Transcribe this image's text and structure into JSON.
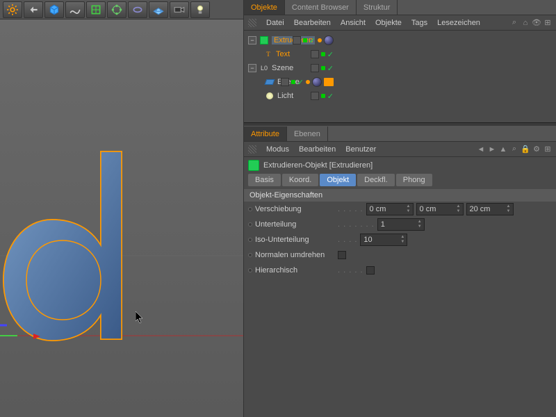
{
  "panel_tabs": {
    "objects": "Objekte",
    "content_browser": "Content Browser",
    "structure": "Struktur"
  },
  "obj_menu": {
    "file": "Datei",
    "edit": "Bearbeiten",
    "view": "Ansicht",
    "objects": "Objekte",
    "tags": "Tags",
    "bookmarks": "Lesezeichen"
  },
  "tree": {
    "extrude": "Extrudieren",
    "text": "Text",
    "scene": "Szene",
    "plane": "Ebene",
    "light": "Licht"
  },
  "attr_tabs": {
    "attributes": "Attribute",
    "layers": "Ebenen"
  },
  "attr_menu": {
    "mode": "Modus",
    "edit": "Bearbeiten",
    "user": "Benutzer"
  },
  "obj_title": "Extrudieren-Objekt [Extrudieren]",
  "subtabs": {
    "basis": "Basis",
    "coord": "Koord.",
    "object": "Objekt",
    "caps": "Deckfl.",
    "phong": "Phong"
  },
  "section": "Objekt-Eigenschaften",
  "props": {
    "movement": "Verschiebung",
    "subdivision": "Unterteilung",
    "iso_subdivision": "Iso-Unterteilung",
    "flip_normals": "Normalen umdrehen",
    "hierarchical": "Hierarchisch"
  },
  "values": {
    "move_x": "0 cm",
    "move_y": "0 cm",
    "move_z": "20 cm",
    "subdiv": "1",
    "iso": "10"
  }
}
